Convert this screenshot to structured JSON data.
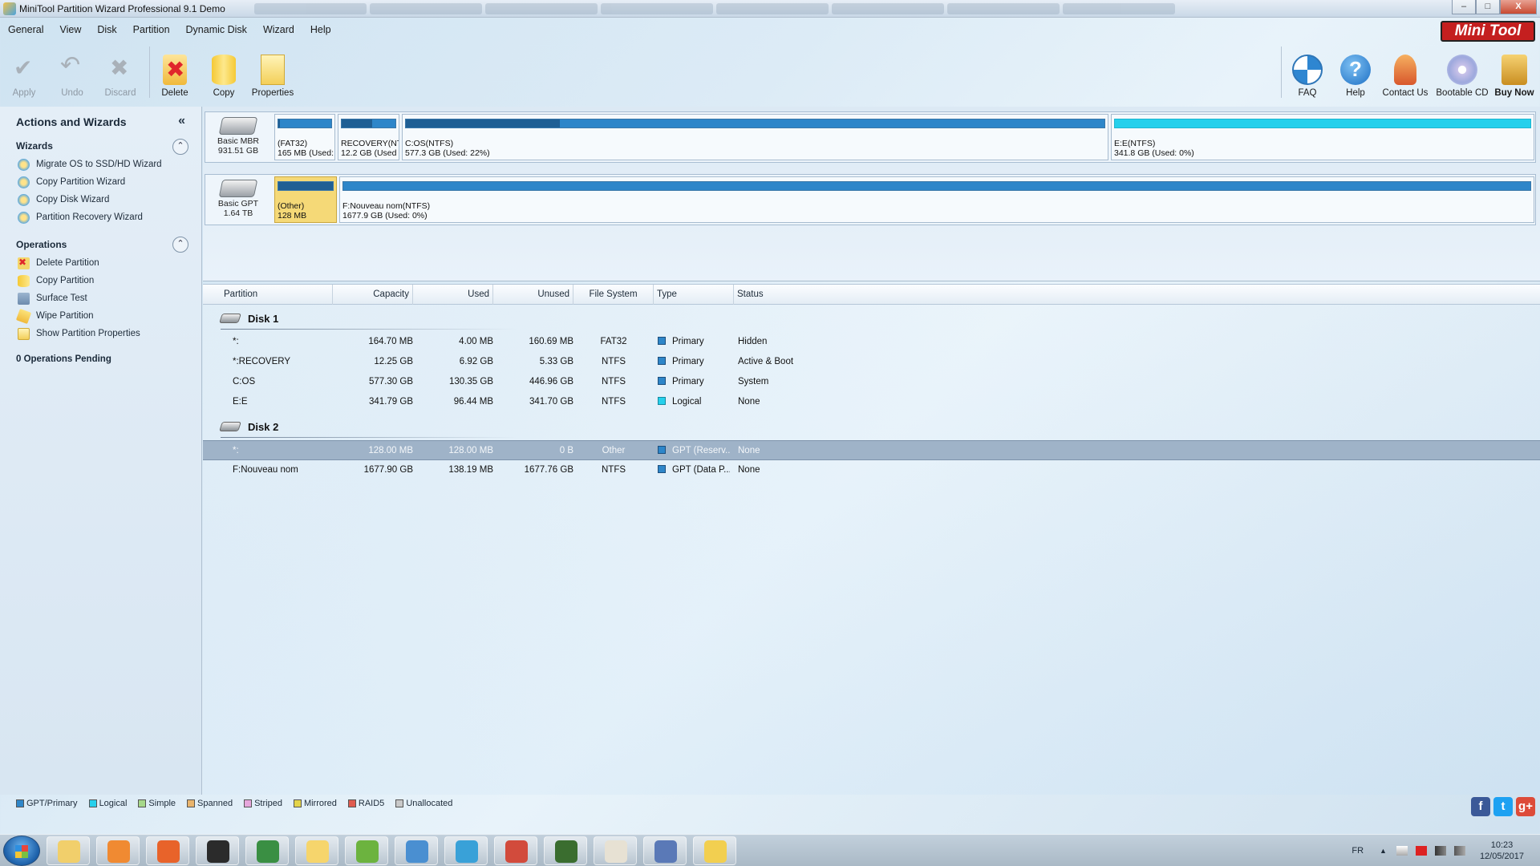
{
  "window": {
    "title": "MiniTool Partition Wizard Professional 9.1 Demo",
    "controls": [
      "–",
      "□",
      "X"
    ]
  },
  "menu": [
    "General",
    "View",
    "Disk",
    "Partition",
    "Dynamic Disk",
    "Wizard",
    "Help"
  ],
  "brand": "Mini Tool",
  "toolbar": {
    "left": [
      {
        "label": "Apply",
        "icon": "apply-icon",
        "enabled": false
      },
      {
        "label": "Undo",
        "icon": "undo-icon",
        "enabled": false
      },
      {
        "label": "Discard",
        "icon": "discard-icon",
        "enabled": false
      },
      {
        "label": "Delete",
        "icon": "delete-icon",
        "enabled": true
      },
      {
        "label": "Copy",
        "icon": "copy-icon",
        "enabled": true
      },
      {
        "label": "Properties",
        "icon": "properties-icon",
        "enabled": true
      }
    ],
    "right": [
      {
        "label": "FAQ",
        "icon": "faq-icon"
      },
      {
        "label": "Help",
        "icon": "help-icon",
        "glyph": "?"
      },
      {
        "label": "Contact Us",
        "icon": "contact-icon"
      },
      {
        "label": "Bootable CD",
        "icon": "bootable-cd-icon"
      },
      {
        "label": "Buy Now",
        "icon": "cart-icon"
      }
    ]
  },
  "sidebar": {
    "title": "Actions and Wizards",
    "collapse_glyph": "«",
    "wizards_title": "Wizards",
    "wizards": [
      "Migrate OS to SSD/HD Wizard",
      "Copy Partition Wizard",
      "Copy Disk Wizard",
      "Partition Recovery Wizard"
    ],
    "operations_title": "Operations",
    "operations": [
      {
        "label": "Delete Partition",
        "icon": "delete-icon"
      },
      {
        "label": "Copy Partition",
        "icon": "copy-icon"
      },
      {
        "label": "Surface Test",
        "icon": "surface-test-icon"
      },
      {
        "label": "Wipe Partition",
        "icon": "wipe-icon"
      },
      {
        "label": "Show Partition Properties",
        "icon": "properties-icon"
      }
    ],
    "pending": "0 Operations Pending"
  },
  "disk_map": [
    {
      "type": "Basic MBR",
      "size": "931.51 GB",
      "partitions": [
        {
          "line1": "(FAT32)",
          "line2": "165 MB (Used:",
          "used": 0.03,
          "kind": "primary"
        },
        {
          "line1": "RECOVERY(NT",
          "line2": "12.2 GB (Used",
          "used": 0.56,
          "kind": "primary"
        },
        {
          "line1": "C:OS(NTFS)",
          "line2": "577.3 GB (Used: 22%)",
          "used": 0.22,
          "kind": "primary"
        },
        {
          "line1": "E:E(NTFS)",
          "line2": "341.8 GB (Used: 0%)",
          "used": 0.0,
          "kind": "logical"
        }
      ]
    },
    {
      "type": "Basic GPT",
      "size": "1.64 TB",
      "partitions": [
        {
          "line1": "(Other)",
          "line2": "128 MB",
          "used": 1.0,
          "kind": "primary",
          "selected": true
        },
        {
          "line1": "F:Nouveau nom(NTFS)",
          "line2": "1677.9 GB (Used: 0%)",
          "used": 0.0,
          "kind": "primary"
        }
      ]
    }
  ],
  "table": {
    "columns": [
      "Partition",
      "Capacity",
      "Used",
      "Unused",
      "File System",
      "Type",
      "Status"
    ],
    "disks": [
      {
        "label": "Disk 1",
        "rows": [
          {
            "partition": "*:",
            "capacity": "164.70 MB",
            "used": "4.00 MB",
            "unused": "160.69 MB",
            "fs": "FAT32",
            "type": "Primary",
            "type_kind": "primary",
            "status": "Hidden"
          },
          {
            "partition": "*:RECOVERY",
            "capacity": "12.25 GB",
            "used": "6.92 GB",
            "unused": "5.33 GB",
            "fs": "NTFS",
            "type": "Primary",
            "type_kind": "primary",
            "status": "Active & Boot"
          },
          {
            "partition": "C:OS",
            "capacity": "577.30 GB",
            "used": "130.35 GB",
            "unused": "446.96 GB",
            "fs": "NTFS",
            "type": "Primary",
            "type_kind": "primary",
            "status": "System"
          },
          {
            "partition": "E:E",
            "capacity": "341.79 GB",
            "used": "96.44 MB",
            "unused": "341.70 GB",
            "fs": "NTFS",
            "type": "Logical",
            "type_kind": "logical",
            "status": "None"
          }
        ]
      },
      {
        "label": "Disk 2",
        "rows": [
          {
            "partition": "*:",
            "capacity": "128.00 MB",
            "used": "128.00 MB",
            "unused": "0 B",
            "fs": "Other",
            "type": "GPT (Reserv...",
            "type_kind": "primary",
            "status": "None",
            "selected": true
          },
          {
            "partition": "F:Nouveau nom",
            "capacity": "1677.90 GB",
            "used": "138.19 MB",
            "unused": "1677.76 GB",
            "fs": "NTFS",
            "type": "GPT (Data P...",
            "type_kind": "primary",
            "status": "None"
          }
        ]
      }
    ]
  },
  "legend": [
    {
      "label": "GPT/Primary",
      "color": "#2e86c9"
    },
    {
      "label": "Logical",
      "color": "#26d0ec"
    },
    {
      "label": "Simple",
      "color": "#a6d88a"
    },
    {
      "label": "Spanned",
      "color": "#e9b46c"
    },
    {
      "label": "Striped",
      "color": "#e6a6dc"
    },
    {
      "label": "Mirrored",
      "color": "#e3d44a"
    },
    {
      "label": "RAID5",
      "color": "#e05b4f"
    },
    {
      "label": "Unallocated",
      "color": "#c9c9c9"
    }
  ],
  "social": [
    {
      "glyph": "f",
      "icon": "facebook-icon",
      "color": "#3b5998"
    },
    {
      "glyph": "t",
      "icon": "twitter-icon",
      "color": "#1da1f2"
    },
    {
      "glyph": "g+",
      "icon": "google-plus-icon",
      "color": "#dd4b39"
    }
  ],
  "taskbar": {
    "apps": [
      {
        "icon": "file-explorer-icon",
        "color": "#f1cf6b"
      },
      {
        "icon": "media-player-icon",
        "color": "#f08a32"
      },
      {
        "icon": "firefox-icon",
        "color": "#e8632a"
      },
      {
        "icon": "wintv-icon",
        "color": "#2b2b2b"
      },
      {
        "icon": "app-icon",
        "color": "#3a8f43"
      },
      {
        "icon": "mail-icon",
        "color": "#f6d56c"
      },
      {
        "icon": "utorrent-icon",
        "color": "#6cb33f"
      },
      {
        "icon": "dell-icon",
        "color": "#4a8fd1"
      },
      {
        "icon": "support-icon",
        "color": "#39a1d8"
      },
      {
        "icon": "toolbox-icon",
        "color": "#d24b3c"
      },
      {
        "icon": "globe-icon",
        "color": "#3a6d2f"
      },
      {
        "icon": "paint-icon",
        "color": "#e7e1d3"
      },
      {
        "icon": "remote-icon",
        "color": "#5a79b7"
      },
      {
        "icon": "partition-wizard-icon",
        "color": "#f2cf50"
      }
    ],
    "language": "FR",
    "time": "10:23",
    "date": "12/05/2017"
  }
}
